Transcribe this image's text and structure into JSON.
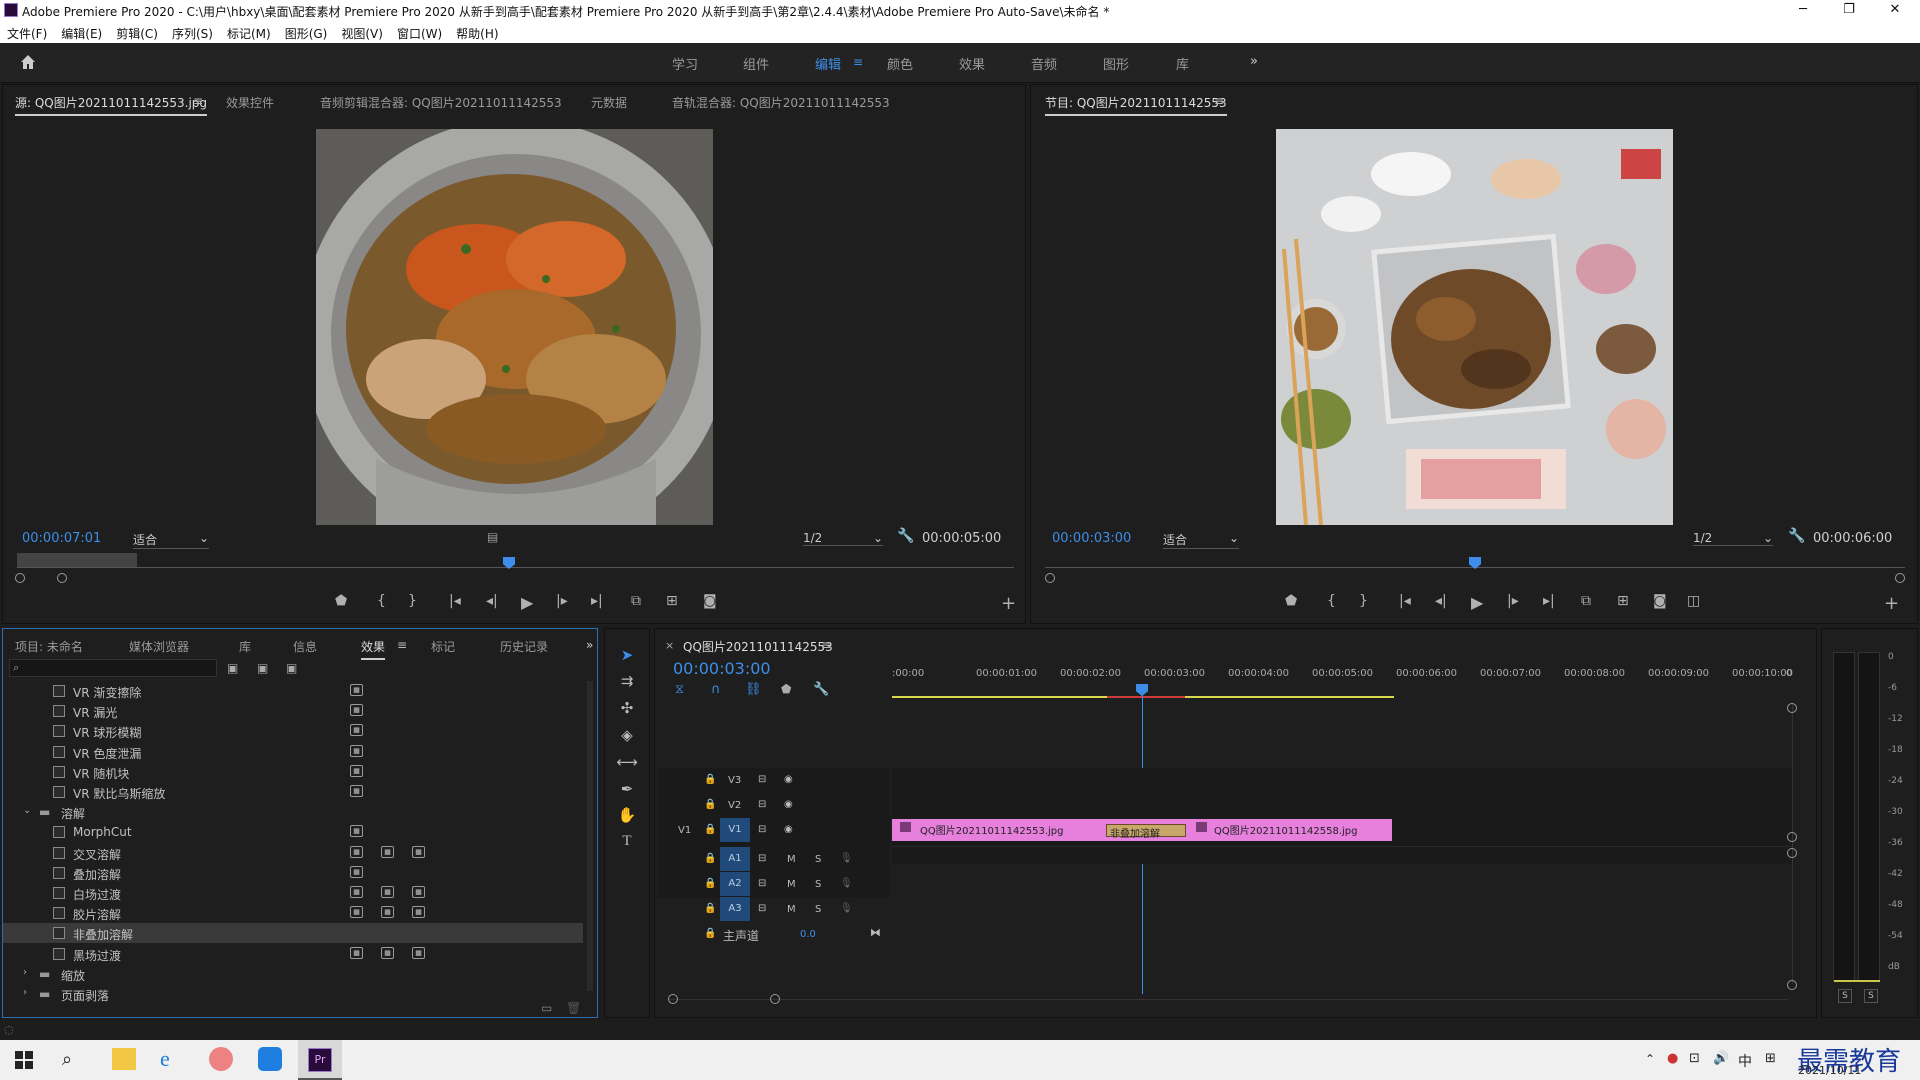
{
  "window": {
    "title": "Adobe Premiere Pro 2020 - C:\\用户\\hbxy\\桌面\\配套素材 Premiere Pro 2020 从新手到高手\\配套素材 Premiere Pro 2020 从新手到高手\\第2章\\2.4.4\\素材\\Adobe Premiere Pro Auto-Save\\未命名 *",
    "minimize": "─",
    "maximize": "❐",
    "close": "✕"
  },
  "menu": [
    "文件(F)",
    "编辑(E)",
    "剪辑(C)",
    "序列(S)",
    "标记(M)",
    "图形(G)",
    "视图(V)",
    "窗口(W)",
    "帮助(H)"
  ],
  "workspaces": [
    "学习",
    "组件",
    "编辑",
    "颜色",
    "效果",
    "音频",
    "图形",
    "库"
  ],
  "workspace_more": "»",
  "source": {
    "tabs": [
      "源: QQ图片20211011142553.jpg",
      "效果控件",
      "音频剪辑混合器: QQ图片20211011142553",
      "元数据",
      "音轨混合器: QQ图片20211011142553"
    ],
    "timecode": "00:00:07:01",
    "fit": "适合",
    "resolution": "1/2",
    "duration": "00:00:05:00"
  },
  "program": {
    "tab": "节目: QQ图片20211011142553",
    "timecode": "00:00:03:00",
    "fit": "适合",
    "resolution": "1/2",
    "duration": "00:00:06:00"
  },
  "project": {
    "tabs": [
      "项目: 未命名",
      "媒体浏览器",
      "库",
      "信息",
      "效果",
      "标记",
      "历史记录"
    ],
    "more": "»"
  },
  "effects": [
    {
      "label": "VR 渐变擦除",
      "indent": 1,
      "badges": 1
    },
    {
      "label": "VR 漏光",
      "indent": 1,
      "badges": 1
    },
    {
      "label": "VR 球形模糊",
      "indent": 1,
      "badges": 1
    },
    {
      "label": "VR 色度泄漏",
      "indent": 1,
      "badges": 1
    },
    {
      "label": "VR 随机块",
      "indent": 1,
      "badges": 1
    },
    {
      "label": "VR 默比乌斯缩放",
      "indent": 1,
      "badges": 1
    },
    {
      "label": "溶解",
      "indent": 0,
      "folder": true,
      "open": true
    },
    {
      "label": "MorphCut",
      "indent": 1,
      "badges": 1
    },
    {
      "label": "交叉溶解",
      "indent": 1,
      "badges": 3
    },
    {
      "label": "叠加溶解",
      "indent": 1,
      "badges": 1
    },
    {
      "label": "白场过渡",
      "indent": 1,
      "badges": 3
    },
    {
      "label": "胶片溶解",
      "indent": 1,
      "badges": 3
    },
    {
      "label": "非叠加溶解",
      "indent": 1,
      "badges": 0,
      "selected": true
    },
    {
      "label": "黑场过渡",
      "indent": 1,
      "badges": 3
    },
    {
      "label": "缩放",
      "indent": 0,
      "folder": true
    },
    {
      "label": "页面剥落",
      "indent": 0,
      "folder": true
    }
  ],
  "timeline": {
    "tab": "QQ图片20211011142553",
    "close": "×",
    "timecode": "00:00:03:00",
    "ruler": [
      ":00:00",
      "00:00:01:00",
      "00:00:02:00",
      "00:00:03:00",
      "00:00:04:00",
      "00:00:05:00",
      "00:00:06:00",
      "00:00:07:00",
      "00:00:08:00",
      "00:00:09:00",
      "00:00:10:00",
      "0"
    ],
    "tracks_video": [
      "V3",
      "V2",
      "V1"
    ],
    "tracks_audio": [
      "A1",
      "A2",
      "A3"
    ],
    "v1_source": "V1",
    "master": "主声道",
    "master_value": "0.0",
    "clip1": "QQ图片20211011142553.jpg",
    "clip2": "QQ图片20211011142558.jpg",
    "transition": "非叠加溶解",
    "mute": "M",
    "solo": "S"
  },
  "meter": {
    "scale": [
      "0",
      "-6",
      "-12",
      "-18",
      "-24",
      "-30",
      "-36",
      "-42",
      "-48",
      "-54",
      "dB"
    ],
    "solo": [
      "S",
      "S"
    ]
  },
  "taskbar": {
    "ime": "中",
    "date": "2021/10/11",
    "watermark": "最需教育"
  }
}
